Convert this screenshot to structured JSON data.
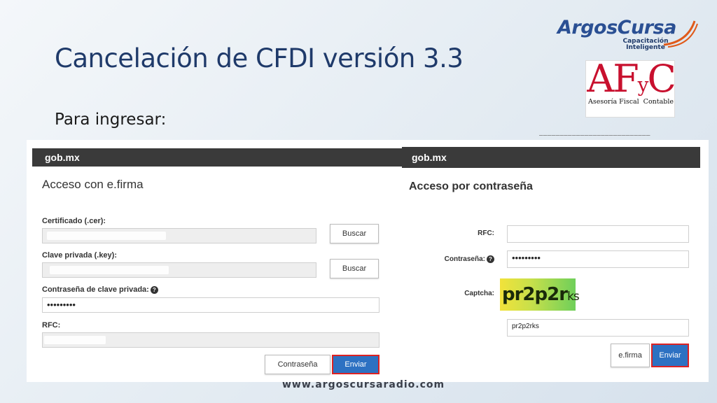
{
  "slide": {
    "title": "Cancelación de CFDI versión 3.3",
    "subtitle": "Para ingresar:",
    "footer_url": "www.argoscursaradio.com"
  },
  "logos": {
    "argos": {
      "name": "ArgosCursa",
      "tagline_1": "Capacitación",
      "tagline_2": "Inteligente"
    },
    "afc": {
      "letter_a": "A",
      "letter_f": "F",
      "letter_y": "y",
      "letter_c": "C",
      "left_text": "Asesoría Fiscal",
      "right_text": "Contable"
    }
  },
  "efirma_form": {
    "header": "gob.mx",
    "heading": "Acceso con e.firma",
    "cert_label": "Certificado (.cer):",
    "cert_button": "Buscar",
    "key_label": "Clave privada (.key):",
    "key_button": "Buscar",
    "password_label": "Contraseña de clave privada:",
    "password_value": "•••••••••",
    "rfc_label": "RFC:",
    "alt_button": "Contraseña",
    "submit_button": "Enviar"
  },
  "password_form": {
    "header": "gob.mx",
    "heading": "Acceso por contraseña",
    "rfc_label": "RFC:",
    "password_label": "Contraseña:",
    "password_value": "•••••••••",
    "captcha_label": "Captcha:",
    "captcha_main": "pr2p2r",
    "captcha_tail": "ks",
    "captcha_input_value": "pr2p2rks",
    "alt_button": "e.firma",
    "submit_button": "Enviar"
  },
  "colors": {
    "title": "#1f3a6a",
    "gob_bar": "#3a3a3a",
    "primary_button": "#2d71c2",
    "highlight": "#dd2222"
  }
}
